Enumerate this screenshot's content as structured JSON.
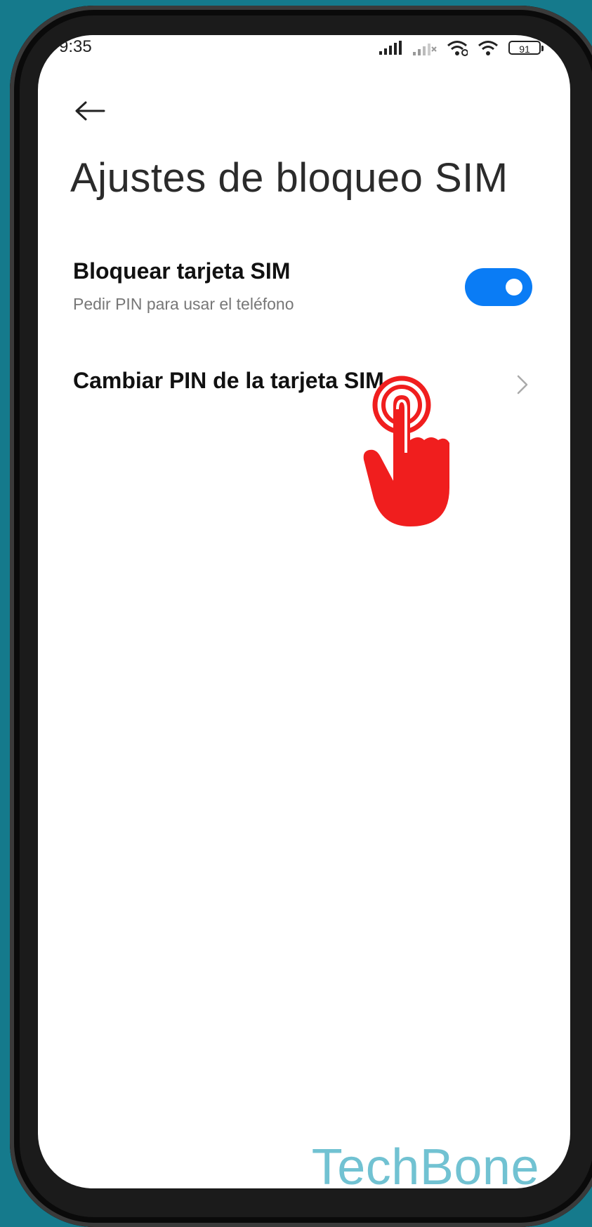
{
  "status_bar": {
    "time": "9:35",
    "battery": "91",
    "icons": [
      "signal-icon",
      "signal-weak-icon",
      "wifi-icon",
      "wifi-icon",
      "battery-icon"
    ]
  },
  "header": {
    "back_icon": "arrow-left-icon",
    "title": "Ajustes de bloqueo SIM"
  },
  "settings": [
    {
      "title": "Bloquear tarjeta SIM",
      "subtitle": "Pedir PIN para usar el teléfono",
      "toggle": true
    },
    {
      "title": "Cambiar PIN de la tarjeta SIM",
      "icon": "chevron-right-icon"
    }
  ],
  "overlay": {
    "gesture_icon": "tap-hand-icon",
    "watermark": "TechBone"
  },
  "colors": {
    "accent": "#0a7cf5",
    "gesture": "#f01e1e",
    "background": "#157a8c",
    "watermark": "#71c2d2"
  }
}
